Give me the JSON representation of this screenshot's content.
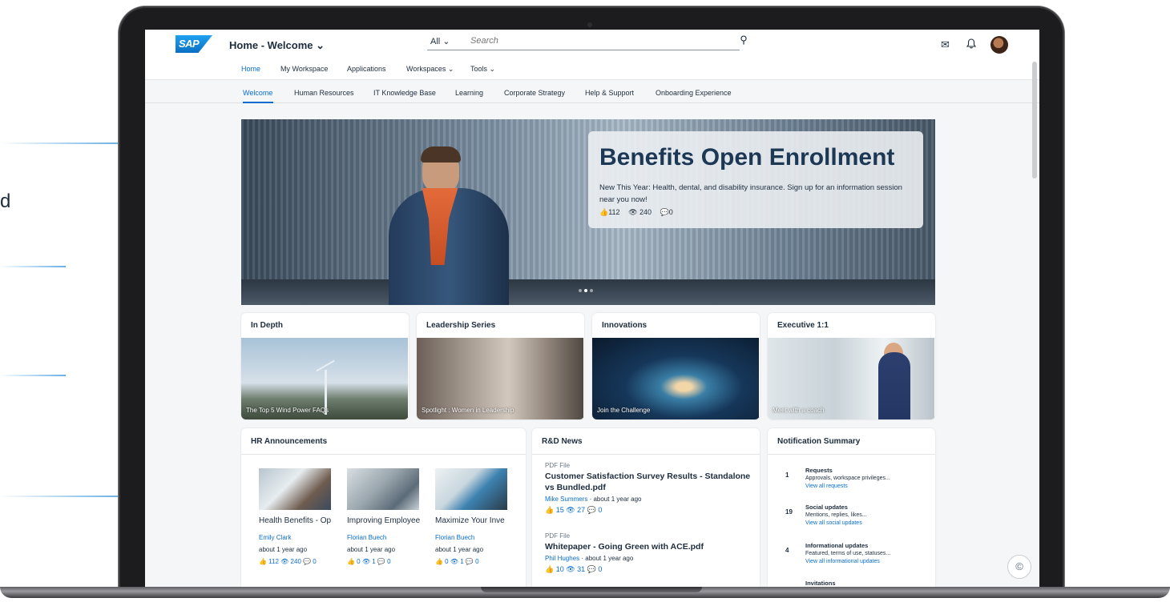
{
  "side_text": "d",
  "shell": {
    "logo": "SAP",
    "title": "Home - Welcome ⌄",
    "search_scope": "All ⌄",
    "search_placeholder": "Search",
    "search_icon": "⚲",
    "inbox_icon": "✉",
    "bell_icon": "♪"
  },
  "nav": {
    "items": [
      "Home",
      "My Workspace",
      "Applications",
      "Workspaces ⌄",
      "Tools ⌄"
    ],
    "active_index": 0
  },
  "tabs": {
    "items": [
      "Welcome",
      "Human Resources",
      "IT Knowledge Base",
      "Learning",
      "Corporate Strategy",
      "Help & Support",
      "Onboarding Experience"
    ],
    "active_index": 0
  },
  "hero": {
    "title": "Benefits Open Enrollment",
    "description": "New This Year: Health, dental, and disability insurance. Sign up for an information session near you now!",
    "likes": "👍112",
    "views": "👁 240",
    "comments": "💬0",
    "carousel_active": 1
  },
  "tiles": [
    {
      "title": "In Depth",
      "caption": "The Top 5 Wind Power FAQs"
    },
    {
      "title": "Leadership Series",
      "caption": "Spotlight : Women in Leadership"
    },
    {
      "title": "Innovations",
      "caption": "Join the Challenge"
    },
    {
      "title": "Executive 1:1",
      "caption": "Meet with a coach"
    }
  ],
  "hr": {
    "title": "HR Announcements",
    "items": [
      {
        "title": "Health Benefits - Op",
        "author": "Emily Clark",
        "time": "about 1 year ago",
        "stats": "👍 112  👁 240  💬 0"
      },
      {
        "title": "Improving Employee",
        "author": "Florian Buech",
        "time": "about 1 year ago",
        "stats": "👍 0  👁 1  💬 0"
      },
      {
        "title": "Maximize Your Inve",
        "author": "Florian Buech",
        "time": "about 1 year ago",
        "stats": "👍 0  👁 1  💬 0"
      }
    ]
  },
  "rd": {
    "title": "R&D News",
    "items": [
      {
        "type": "PDF File",
        "title": "Customer Satisfaction Survey Results - Standalone vs Bundled.pdf",
        "author": "Mike Summers",
        "time": " · about 1 year ago",
        "stats": "👍 15  👁 27  💬 0"
      },
      {
        "type": "PDF File",
        "title": "Whitepaper - Going Green with ACE.pdf",
        "author": "Phil Hughes",
        "time": " · about 1 year ago",
        "stats": "👍 10  👁 31  💬 0"
      }
    ]
  },
  "notifications": {
    "title": "Notification Summary",
    "items": [
      {
        "count": "1",
        "title": "Requests",
        "desc": "Approvals, workspace privileges...",
        "link": "View all requests"
      },
      {
        "count": "19",
        "title": "Social updates",
        "desc": "Mentions, replies, likes...",
        "link": "View all social updates"
      },
      {
        "count": "4",
        "title": "Informational updates",
        "desc": "Featured, terms of use, statuses...",
        "link": "View all informational updates"
      },
      {
        "count": "",
        "title": "Invitations",
        "desc": "",
        "link": ""
      }
    ]
  },
  "fab_icon": "©"
}
